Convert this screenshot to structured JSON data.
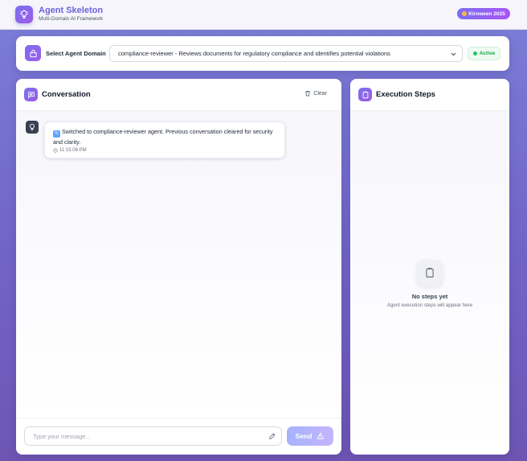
{
  "header": {
    "title": "Agent Skeleton",
    "subtitle": "Multi-Domain AI Framework",
    "badge": "Kiroween 2025"
  },
  "domain": {
    "label": "Select Agent Domain",
    "selected": "compliance-reviewer - Reviews documents for regulatory compliance and identifies potential violations",
    "status": "Active"
  },
  "conversation": {
    "title": "Conversation",
    "clear_label": "Clear",
    "messages": [
      {
        "text": "Switched to compliance-reviewer agent. Previous conversation cleared for security and clarity.",
        "time": "11:15:06 PM"
      }
    ],
    "input_placeholder": "Type your message...",
    "send_label": "Send"
  },
  "steps": {
    "title": "Execution Steps",
    "empty_title": "No steps yet",
    "empty_subtitle": "Agent execution steps will appear here"
  },
  "colors": {
    "accent": "#7b6ff0",
    "active": "#22c55e",
    "background": "#7266c8"
  }
}
